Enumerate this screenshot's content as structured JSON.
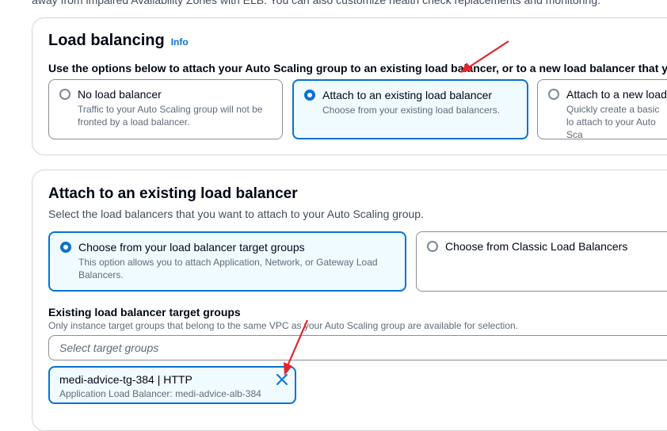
{
  "top_fragment": "away from impaired Availability Zones with ELB. You can also customize health check replacements and monitoring.",
  "load_balancing": {
    "title": "Load balancing",
    "info": "Info",
    "instruction": "Use the options below to attach your Auto Scaling group to an existing load balancer, or to a new load balancer that yo",
    "options": [
      {
        "title": "No load balancer",
        "desc": "Traffic to your Auto Scaling group will not be fronted by a load balancer.",
        "selected": false
      },
      {
        "title": "Attach to an existing load balancer",
        "desc": "Choose from your existing load balancers.",
        "selected": true
      },
      {
        "title": "Attach to a new load",
        "desc": "Quickly create a basic lo attach to your Auto Sca",
        "selected": false
      }
    ]
  },
  "attach_existing": {
    "title": "Attach to an existing load balancer",
    "subtitle": "Select the load balancers that you want to attach to your Auto Scaling group.",
    "options": [
      {
        "title": "Choose from your load balancer target groups",
        "desc": "This option allows you to attach Application, Network, or Gateway Load Balancers.",
        "selected": true
      },
      {
        "title": "Choose from Classic Load Balancers",
        "desc": "",
        "selected": false
      }
    ],
    "target_groups_label": "Existing load balancer target groups",
    "target_groups_hint": "Only instance target groups that belong to the same VPC as your Auto Scaling group are available for selection.",
    "select_placeholder": "Select target groups",
    "selected_token": {
      "title": "medi-advice-tg-384 | HTTP",
      "desc": "Application Load Balancer: medi-advice-alb-384"
    }
  },
  "colors": {
    "accent": "#0972d3",
    "selected_bg": "#f0fbff",
    "annotation_arrow": "#e3242b"
  },
  "icons": {
    "token_remove": "close-icon",
    "annotation": "arrow-annotation"
  }
}
